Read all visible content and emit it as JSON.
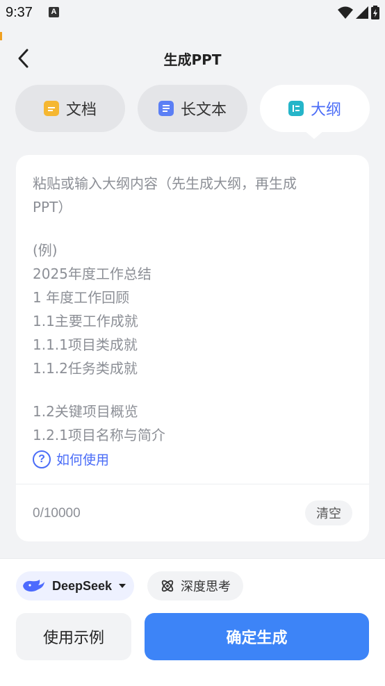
{
  "status_bar": {
    "time": "9:37",
    "notification_badge": "A"
  },
  "header": {
    "title": "生成PPT",
    "back_icon": "chevron-left-icon"
  },
  "tabs": [
    {
      "label": "文档",
      "icon": "document-icon",
      "color": "#f5b731",
      "active": false
    },
    {
      "label": "长文本",
      "icon": "text-icon",
      "color": "#5b7ff5",
      "active": false
    },
    {
      "label": "大纲",
      "icon": "outline-icon",
      "color": "#25b5c9",
      "active": true
    }
  ],
  "editor": {
    "placeholder_lines": [
      "粘贴或输入大纲内容（先生成大纲，再生成",
      "PPT）",
      "",
      "(例)",
      "2025年度工作总结",
      "1 年度工作回顾",
      "1.1主要工作成就",
      "1.1.1项目类成就",
      "1.1.2任务类成就",
      "",
      "1.2关键项目概览",
      "1.2.1项目名称与简介"
    ],
    "help_label": "如何使用",
    "char_count": "0/10000",
    "clear_label": "清空"
  },
  "bottom": {
    "model_label": "DeepSeek",
    "deep_think_label": "深度思考",
    "example_label": "使用示例",
    "confirm_label": "确定生成"
  },
  "colors": {
    "accent": "#4a6cf7",
    "primary_button": "#3d84f7",
    "background": "#f2f3f5"
  }
}
